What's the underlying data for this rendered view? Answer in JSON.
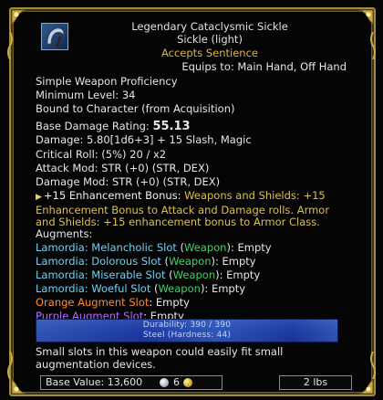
{
  "item": {
    "rarity_name": "Legendary Cataclysmic Sickle",
    "subtype": "Sickle (light)",
    "sentience": "Accepts Sentience",
    "equips_to": "Equips to: Main Hand, Off Hand"
  },
  "requirements": {
    "proficiency": "Simple Weapon Proficiency",
    "min_level": "Minimum Level: 34",
    "bound": "Bound to Character (from Acquisition)"
  },
  "stats": {
    "base_damage_label": "Base Damage Rating:",
    "base_damage_value": "55.13",
    "damage": "Damage: 5.80[1d6+3] + 15 Slash, Magic",
    "critical": "Critical Roll: (5%) 20 / x2",
    "attack_mod": "Attack Mod: STR (+0) (STR, DEX)",
    "damage_mod": "Damage Mod: STR (+0) (STR, DEX)"
  },
  "enhancement": {
    "lead": "+15 Enhancement Bonus:",
    "text_1": " Weapons and Shields: +15",
    "text_2": "Enhancement Bonus to Attack and Damage rolls. Armor",
    "text_3": "and Shields: +15 enhancement bonus to Armor Class."
  },
  "augments": {
    "header": "Augments:",
    "slots": [
      {
        "name": "Lamordia: Melancholic Slot",
        "open": " (",
        "type": "Weapon",
        "close": "): Empty"
      },
      {
        "name": "Lamordia: Dolorous Slot",
        "open": " (",
        "type": "Weapon",
        "close": "): Empty"
      },
      {
        "name": "Lamordia: Miserable Slot",
        "open": " (",
        "type": "Weapon",
        "close": "): Empty"
      },
      {
        "name": "Lamordia: Woeful Slot",
        "open": " (",
        "type": "Weapon",
        "close": "): Empty"
      }
    ],
    "orange": {
      "name": "Orange Augment Slot",
      "status": ": Empty"
    },
    "purple": {
      "name": "Purple Augment Slot",
      "status": ": Empty"
    }
  },
  "durability": {
    "text": "Durability: 390 / 390",
    "material": "Steel (Hardness: 44)",
    "fraction": 1.0
  },
  "description": "Small slots in this weapon could easily fit small augmentation devices.",
  "footer": {
    "base_value": "Base Value: 13,600",
    "shards": "6",
    "weight": "2 lbs"
  },
  "colors": {
    "gold": "#d7b649",
    "augment_blue": "#74d0f0",
    "augment_green": "#40d06a",
    "orange": "#ff8a2e",
    "purple": "#b06bff",
    "durability": "#2b4da8"
  },
  "icons": {
    "item": "sickle-icon",
    "platinum": "platinum-coin-icon",
    "shard": "gold-coin-icon"
  }
}
